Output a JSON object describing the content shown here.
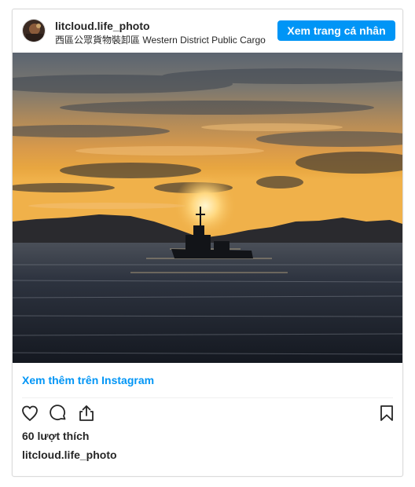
{
  "post": {
    "username": "litcloud.life_photo",
    "location": "西區公眾貨物裝卸區 Western District Public Cargo",
    "view_profile_label": "Xem trang cá nhân",
    "see_more_label": "Xem thêm trên Instagram",
    "likes_text": "60 lượt thích",
    "caption_username": "litcloud.life_photo"
  },
  "icons": {
    "like": "heart-icon",
    "comment": "comment-icon",
    "share": "share-icon",
    "save": "bookmark-icon"
  },
  "colors": {
    "accent": "#0095f6",
    "text": "#262626",
    "border": "#dbdbdb"
  }
}
